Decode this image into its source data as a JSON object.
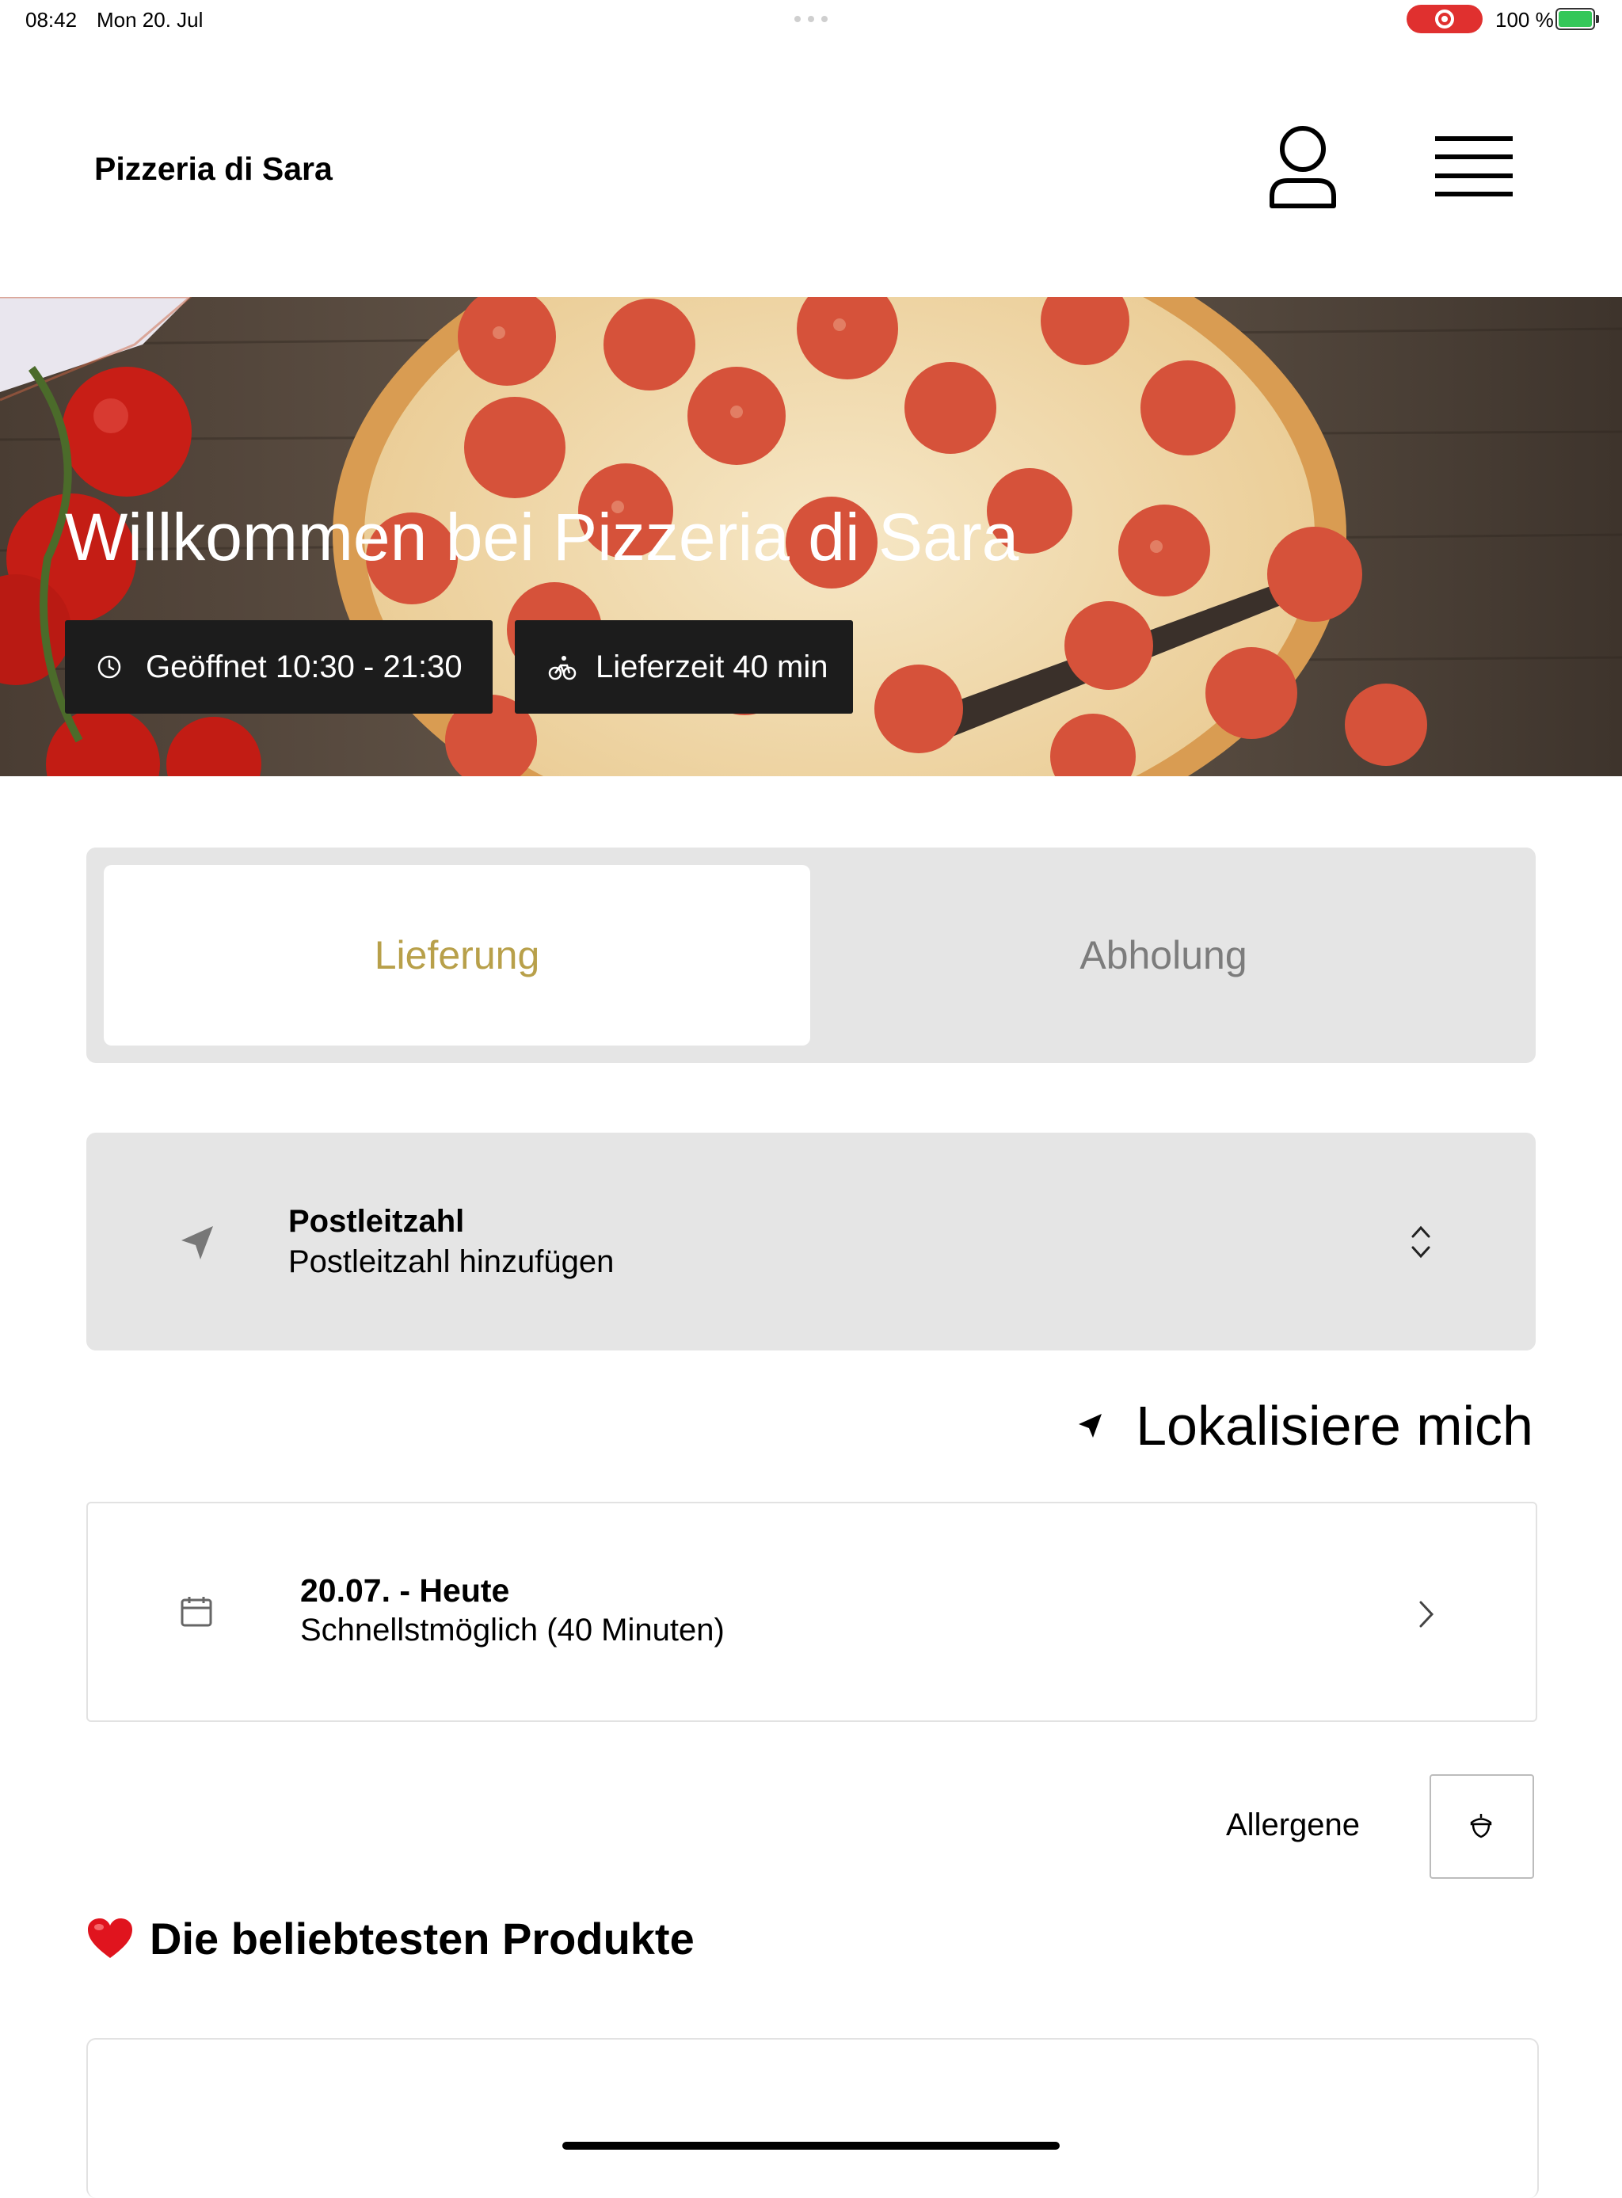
{
  "status_bar": {
    "time": "08:42",
    "date": "Mon 20. Jul",
    "battery": "100 %"
  },
  "header": {
    "brand": "Pizzeria di Sara"
  },
  "hero": {
    "title": "Willkommen bei Pizzeria di Sara",
    "opening_hours": "Geöffnet 10:30 - 21:30",
    "delivery_time": "Lieferzeit 40 min"
  },
  "mode_toggle": {
    "delivery": "Lieferung",
    "pickup": "Abholung",
    "selected": "Lieferung"
  },
  "postal_code": {
    "title": "Postleitzahl",
    "placeholder": "Postleitzahl hinzufügen"
  },
  "locate": {
    "label": "Lokalisiere mich"
  },
  "schedule": {
    "date": "20.07. - Heute",
    "time": "Schnellstmöglich (40 Minuten)"
  },
  "allergens": {
    "label": "Allergene"
  },
  "popular": {
    "title": "Die beliebtesten Produkte"
  },
  "colors": {
    "accent": "#b8a04a",
    "chip_bg": "#1c1c1c",
    "segment_bg": "#e5e5e5",
    "recording": "#e0302f"
  }
}
